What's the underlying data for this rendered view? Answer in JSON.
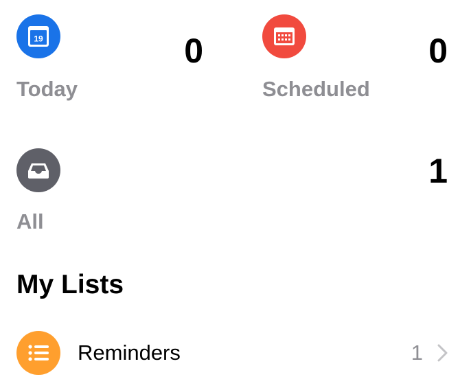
{
  "smart_lists": {
    "today": {
      "label": "Today",
      "count": "0",
      "icon": "calendar-today-icon",
      "icon_day": "19",
      "color": "#1a73e8"
    },
    "scheduled": {
      "label": "Scheduled",
      "count": "0",
      "icon": "calendar-icon",
      "color": "#f14a3e"
    },
    "all": {
      "label": "All",
      "count": "1",
      "icon": "tray-icon",
      "color": "#5f6068"
    }
  },
  "my_lists": {
    "title": "My Lists",
    "items": [
      {
        "name": "Reminders",
        "count": "1",
        "icon": "list-bullet-icon",
        "color": "#ff9f2e"
      }
    ]
  }
}
